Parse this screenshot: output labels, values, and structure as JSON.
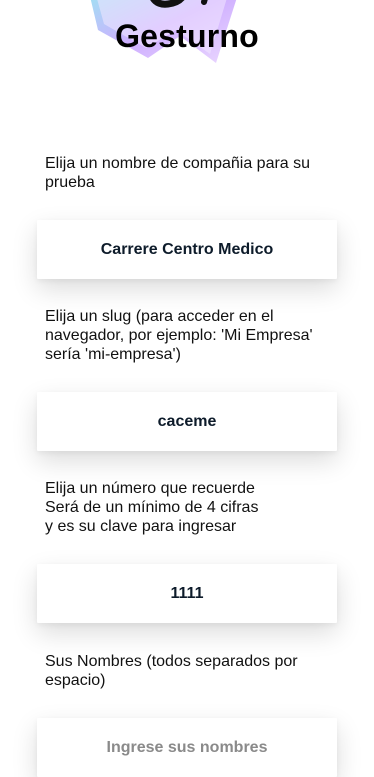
{
  "app": {
    "brand_name": "Gesturno",
    "logo_icon": "gesturno-hand-logo-icon",
    "accent_colors": [
      "#c9a6ff",
      "#8fe3f0",
      "#111111"
    ]
  },
  "form": {
    "company_label": "Elija un nombre de compañia para su prueba",
    "company_value": "Carrere Centro Medico",
    "slug_label": "Elija un slug (para acceder en el navegador, por ejemplo: 'Mi Empresa' sería 'mi-empresa')",
    "slug_value": "caceme",
    "pin_label": "Elija un número que recuerde\nSerá de un mínimo de 4 cifras\ny es su clave para ingresar",
    "pin_value": "1111",
    "names_label": "Sus Nombres (todos separados por espacio)",
    "names_value": "",
    "names_placeholder": "Ingrese sus nombres"
  }
}
